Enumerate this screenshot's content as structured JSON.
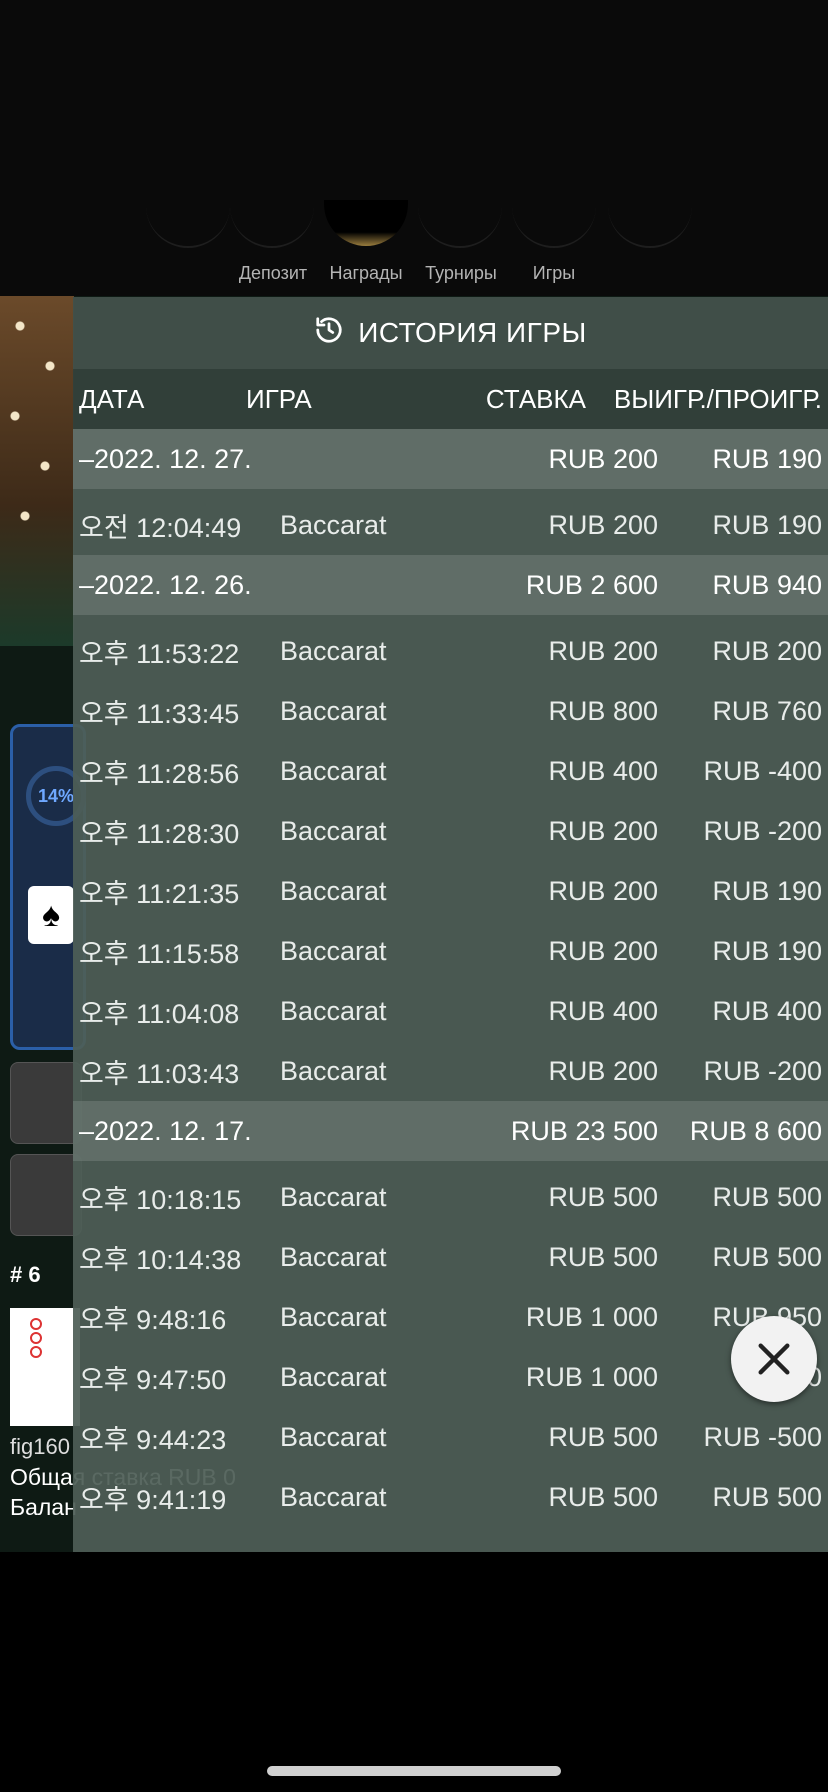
{
  "nav": {
    "items": [
      {
        "label": "Депозит"
      },
      {
        "label": "Награды"
      },
      {
        "label": "Турниры"
      },
      {
        "label": "Игры"
      }
    ]
  },
  "background": {
    "progress_text": "14%",
    "spade_icon": "spade-icon",
    "round_label": "# 6",
    "thumb_label": "fig160",
    "total_bet_label": "Общая ставка RUB 0",
    "balance_label": "Балан"
  },
  "history": {
    "title": "ИСТОРИЯ ИГРЫ",
    "title_icon": "history-icon",
    "columns": {
      "date": "ДАТА",
      "game": "ИГРА",
      "bet": "СТАВКА",
      "win": "ВЫИГР./ПРОИГР."
    },
    "groups": [
      {
        "date": "–2022. 12. 27.",
        "bet": "RUB 200",
        "win": "RUB 190",
        "rows": [
          {
            "time": "오전 12:04:49",
            "game": "Baccarat",
            "bet": "RUB 200",
            "win": "RUB 190"
          }
        ]
      },
      {
        "date": "–2022. 12. 26.",
        "bet": "RUB 2 600",
        "win": "RUB 940",
        "rows": [
          {
            "time": "오후 11:53:22",
            "game": "Baccarat",
            "bet": "RUB 200",
            "win": "RUB 200"
          },
          {
            "time": "오후 11:33:45",
            "game": "Baccarat",
            "bet": "RUB 800",
            "win": "RUB 760"
          },
          {
            "time": "오후 11:28:56",
            "game": "Baccarat",
            "bet": "RUB 400",
            "win": "RUB -400"
          },
          {
            "time": "오후 11:28:30",
            "game": "Baccarat",
            "bet": "RUB 200",
            "win": "RUB -200"
          },
          {
            "time": "오후 11:21:35",
            "game": "Baccarat",
            "bet": "RUB 200",
            "win": "RUB 190"
          },
          {
            "time": "오후 11:15:58",
            "game": "Baccarat",
            "bet": "RUB 200",
            "win": "RUB 190"
          },
          {
            "time": "오후 11:04:08",
            "game": "Baccarat",
            "bet": "RUB 400",
            "win": "RUB 400"
          },
          {
            "time": "오후 11:03:43",
            "game": "Baccarat",
            "bet": "RUB 200",
            "win": "RUB -200"
          }
        ]
      },
      {
        "date": "–2022. 12. 17.",
        "bet": "RUB 23 500",
        "win": "RUB 8 600",
        "rows": [
          {
            "time": "오후 10:18:15",
            "game": "Baccarat",
            "bet": "RUB 500",
            "win": "RUB 500"
          },
          {
            "time": "오후 10:14:38",
            "game": "Baccarat",
            "bet": "RUB 500",
            "win": "RUB 500"
          },
          {
            "time": "오후 9:48:16",
            "game": "Baccarat",
            "bet": "RUB 1 000",
            "win": "RUB 950"
          },
          {
            "time": "오후 9:47:50",
            "game": "Baccarat",
            "bet": "RUB 1 000",
            "win": "RUB 0"
          },
          {
            "time": "오후 9:44:23",
            "game": "Baccarat",
            "bet": "RUB 500",
            "win": "RUB -500"
          },
          {
            "time": "오후 9:41:19",
            "game": "Baccarat",
            "bet": "RUB 500",
            "win": "RUB 500"
          }
        ]
      }
    ]
  },
  "close_icon": "close-icon"
}
